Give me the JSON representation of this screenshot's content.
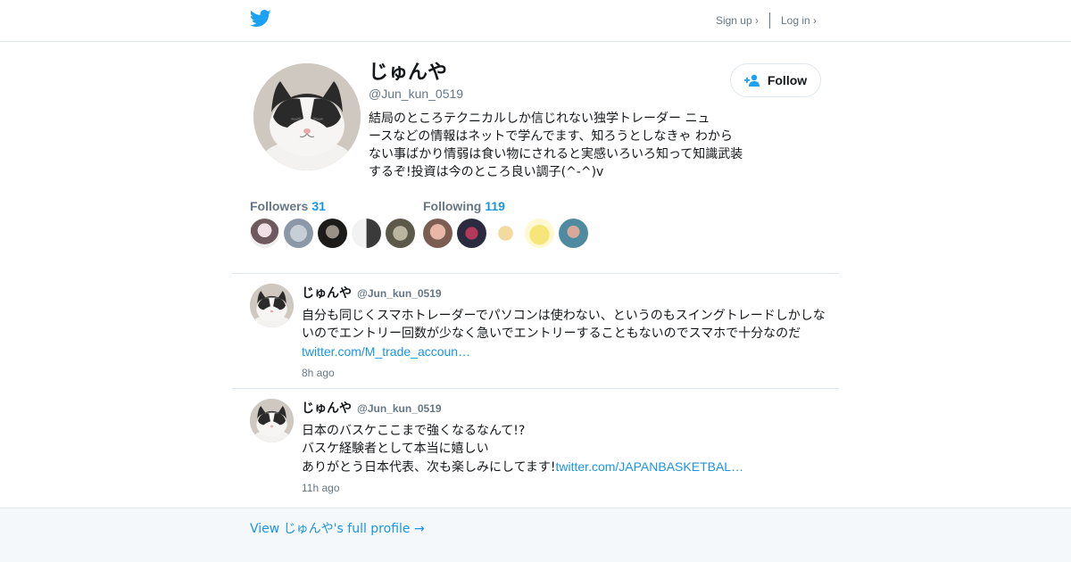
{
  "header": {
    "logo_icon": "twitter-bird-icon",
    "signup_label": "Sign up ›",
    "login_label": "Log in ›",
    "brand_color": "#1da1f2"
  },
  "profile": {
    "display_name": "じゅんや",
    "handle": "@Jun_kun_0519",
    "bio": [
      "結局のところテクニカルしか信じれない独学トレーダー ニュ",
      "ースなどの情報はネットで学んでます、知ろうとしなきゃ わから",
      "ない事ばかり情弱は食い物にされると実感いろいろ知って知識武装",
      "するぞ!投資は今のところ良い調子(^-^)v"
    ],
    "follow_label": "Follow",
    "followers_label": "Followers",
    "followers_count": "31",
    "following_label": "Following",
    "following_count": "119"
  },
  "tweets": [
    {
      "name": "じゅんや",
      "handle": "@Jun_kun_0519",
      "text_lines": [
        "自分も同じくスマホトレーダーでパソコンは使わない、というのもスイングトレードしかしな",
        "いのでエントリー回数が少なく急いでエントリーすることもないのでスマホで十分なのだ"
      ],
      "text_prefix": "",
      "link": "twitter.com/M_trade_accoun…",
      "time": "8h ago"
    },
    {
      "name": "じゅんや",
      "handle": "@Jun_kun_0519",
      "text_lines": [
        "日本のバスケここまで強くなるなんて!?",
        "バスケ経験者として本当に嬉しい"
      ],
      "text_prefix": "ありがとう日本代表、次も楽しみにしてます!",
      "link": "twitter.com/JAPANBASKETBAL…",
      "time": "11h ago"
    }
  ],
  "footer": {
    "full_profile_link": "View じゅんや's full profile →"
  },
  "colors": {
    "link": "#1b95e0",
    "muted": "#657786",
    "border": "#e1e8ed",
    "footer_bg": "#f5f8fa"
  }
}
